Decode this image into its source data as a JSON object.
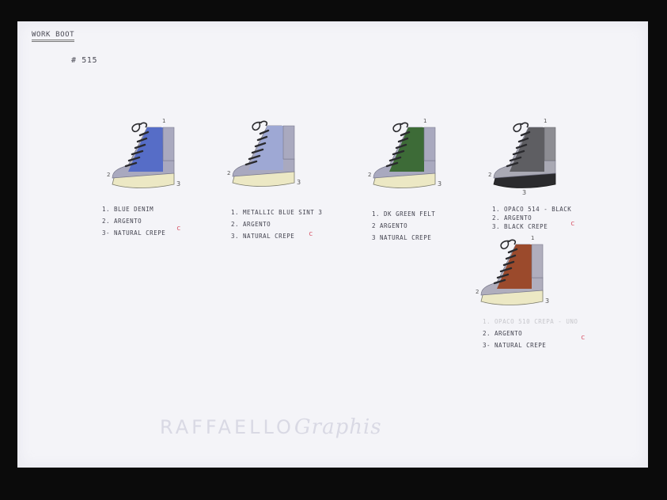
{
  "sheet": {
    "title": "WORK BOOT",
    "model_number": "# 515",
    "watermark": {
      "brand": "RAFFAELLO",
      "script": "Graphis"
    }
  },
  "callout_labels": {
    "upper": "1",
    "toe": "2",
    "sole": "3"
  },
  "colorways": [
    {
      "upper_color": "#4f68c8",
      "toe_color": "#a9a9bf",
      "sole_color": "#ece8c4",
      "notes": [
        "1. BLUE DENIM",
        "2. ARGENTO",
        "3- NATURAL CREPE"
      ],
      "mark": "c"
    },
    {
      "upper_color": "#9ea8d4",
      "toe_color": "#a9a9bf",
      "sole_color": "#ece8c4",
      "notes": [
        "1. METALLIC BLUE SINT 3",
        "2. ARGENTO",
        "3. NATURAL CREPE"
      ],
      "mark": "c"
    },
    {
      "upper_color": "#3d6b37",
      "toe_color": "#a9a9bf",
      "sole_color": "#ece8c4",
      "notes": [
        "1. DK GREEN FELT",
        "2 ARGENTO",
        "3 NATURAL CREPE"
      ],
      "mark": ""
    },
    {
      "upper_color": "#5e5e62",
      "toe_color": "#a9a9b4",
      "sole_color": "#2b2b2e",
      "notes": [
        "1. OPACO 514 - BLACK",
        "2. ARGENTO",
        "3. BLACK CREPE"
      ],
      "mark": "c"
    },
    {
      "upper_color": "#9b4a2c",
      "toe_color": "#b0aebd",
      "sole_color": "#ece8c4",
      "notes": [
        "1. OPACO 510 CREPA - UNO",
        "2. ARGENTO",
        "3- NATURAL CREPE"
      ],
      "mark": "c"
    }
  ]
}
